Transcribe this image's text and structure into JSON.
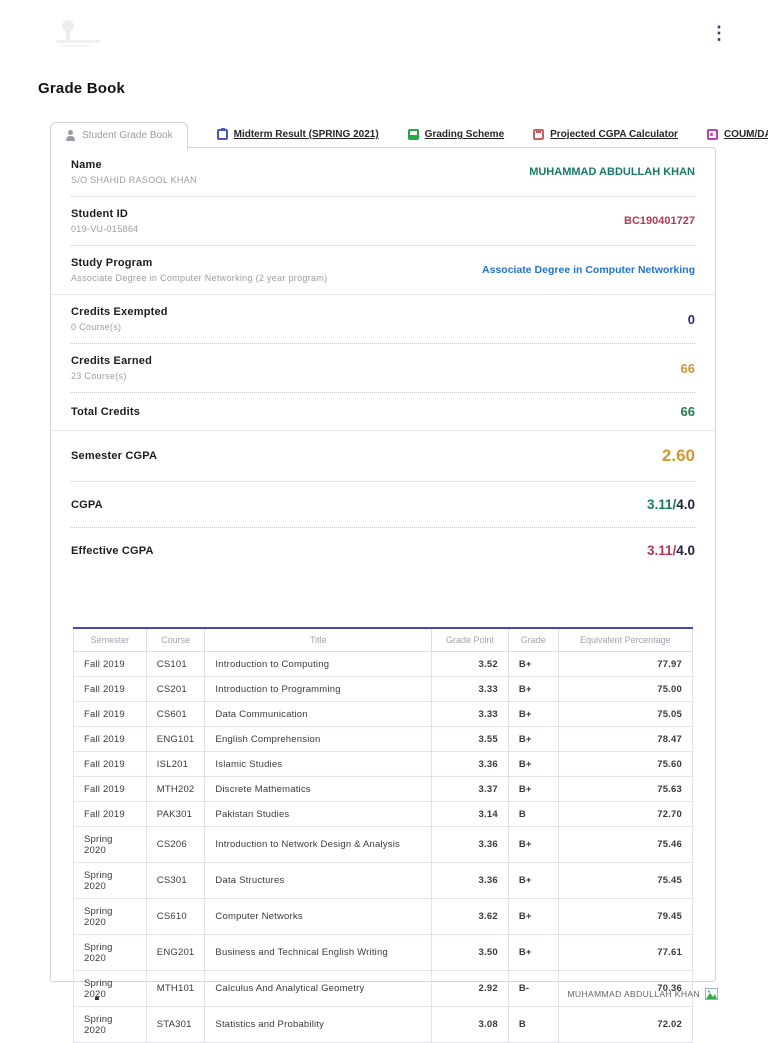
{
  "page": {
    "heading": "Grade Book"
  },
  "tabs": [
    {
      "label": "Student Grade Book",
      "icon": "person",
      "active": true
    },
    {
      "label": "Midterm Result (SPRING 2021)",
      "icon": "clipboard",
      "active": false
    },
    {
      "label": "Grading Scheme",
      "icon": "image",
      "active": false
    },
    {
      "label": "Projected CGPA Calculator",
      "icon": "calc",
      "active": false
    },
    {
      "label": "COUM/DAC",
      "icon": "card",
      "active": false
    }
  ],
  "profile": [
    {
      "label": "Name",
      "sublabel": "S/O SHAHID RASOOL KHAN",
      "value": "MUHAMMAD ABDULLAH KHAN",
      "value_class": "v-teal"
    },
    {
      "label": "Student ID",
      "sublabel": "019-VU-015864",
      "value": "BC190401727",
      "value_class": "v-red"
    },
    {
      "label": "Study Program",
      "sublabel": "Associate Degree in Computer Networking (2 year program)",
      "value": "Associate Degree in Computer Networking",
      "value_class": "v-blue"
    }
  ],
  "credits": [
    {
      "label": "Credits Exempted",
      "sublabel": "0 Course(s)",
      "value": "0",
      "value_class": "v-navy v-md"
    },
    {
      "label": "Credits Earned",
      "sublabel": "23 Course(s)",
      "value": "66",
      "value_class": "v-amber v-md"
    },
    {
      "label": "Total Credits",
      "sublabel": "",
      "value": "66",
      "value_class": "v-green v-md"
    }
  ],
  "cgpa": [
    {
      "label": "Semester CGPA",
      "value": "2.60",
      "suffix": "",
      "value_class": "v-amber v-big"
    },
    {
      "label": "CGPA",
      "value": "3.11/",
      "suffix": "4.0",
      "value_class": "v-teal v-cg"
    },
    {
      "label": "Effective CGPA",
      "value": "3.11/",
      "suffix": "4.0",
      "value_class": "v-red v-cg"
    }
  ],
  "table": {
    "headers": [
      "Semester",
      "Course",
      "Title",
      "Grade Point",
      "Grade",
      "Equivalent Percentage"
    ],
    "rows": [
      {
        "semester": "Fall 2019",
        "course": "CS101",
        "title": "Introduction to Computing",
        "grade_point": "3.52",
        "grade": "B+",
        "percentage": "77.97"
      },
      {
        "semester": "Fall 2019",
        "course": "CS201",
        "title": "Introduction to Programming",
        "grade_point": "3.33",
        "grade": "B+",
        "percentage": "75.00"
      },
      {
        "semester": "Fall 2019",
        "course": "CS601",
        "title": "Data Communication",
        "grade_point": "3.33",
        "grade": "B+",
        "percentage": "75.05"
      },
      {
        "semester": "Fall 2019",
        "course": "ENG101",
        "title": "English Comprehension",
        "grade_point": "3.55",
        "grade": "B+",
        "percentage": "78.47"
      },
      {
        "semester": "Fall 2019",
        "course": "ISL201",
        "title": "Islamic Studies",
        "grade_point": "3.36",
        "grade": "B+",
        "percentage": "75.60"
      },
      {
        "semester": "Fall 2019",
        "course": "MTH202",
        "title": "Discrete Mathematics",
        "grade_point": "3.37",
        "grade": "B+",
        "percentage": "75.63"
      },
      {
        "semester": "Fall 2019",
        "course": "PAK301",
        "title": "Pakistan Studies",
        "grade_point": "3.14",
        "grade": "B",
        "percentage": "72.70"
      },
      {
        "semester": "Spring 2020",
        "course": "CS206",
        "title": "Introduction to Network Design & Analysis",
        "grade_point": "3.36",
        "grade": "B+",
        "percentage": "75.46"
      },
      {
        "semester": "Spring 2020",
        "course": "CS301",
        "title": "Data Structures",
        "grade_point": "3.36",
        "grade": "B+",
        "percentage": "75.45"
      },
      {
        "semester": "Spring 2020",
        "course": "CS610",
        "title": "Computer Networks",
        "grade_point": "3.62",
        "grade": "B+",
        "percentage": "79.45"
      },
      {
        "semester": "Spring 2020",
        "course": "ENG201",
        "title": "Business and Technical English Writing",
        "grade_point": "3.50",
        "grade": "B+",
        "percentage": "77.61"
      },
      {
        "semester": "Spring 2020",
        "course": "MTH101",
        "title": "Calculus And Analytical Geometry",
        "grade_point": "2.92",
        "grade": "B-",
        "percentage": "70.36"
      },
      {
        "semester": "Spring 2020",
        "course": "STA301",
        "title": "Statistics and Probability",
        "grade_point": "3.08",
        "grade": "B",
        "percentage": "72.02"
      }
    ]
  },
  "footer": {
    "student_name": "MUHAMMAD ABDULLAH KHAN"
  },
  "colors": {
    "accent_teal": "#17796a",
    "accent_red": "#b13a52",
    "accent_blue": "#1e74cf",
    "accent_navy": "#2b2b6e",
    "accent_amber": "#cc9833",
    "accent_green": "#1e7a4d",
    "grade_blue": "#2525d9",
    "percentage_blue": "#2e6fc5",
    "table_top_border": "#3f4cb5"
  }
}
